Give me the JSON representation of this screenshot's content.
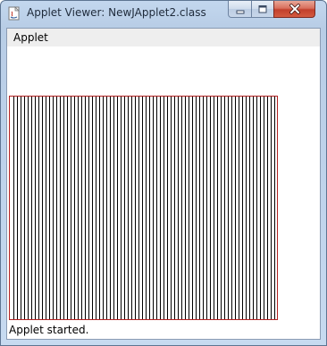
{
  "window": {
    "title": "Applet Viewer: NewJApplet2.class"
  },
  "menubar": {
    "items": [
      {
        "label": "Applet"
      }
    ]
  },
  "applet": {
    "drawing": {
      "stroke_color": "#b22222",
      "line_color": "#000000",
      "vertical_line_count": 74
    }
  },
  "status": {
    "text": "Applet started."
  },
  "icons": {
    "app": "java-applet-icon",
    "minimize": "minimize-icon",
    "maximize": "maximize-icon",
    "close": "close-icon"
  }
}
